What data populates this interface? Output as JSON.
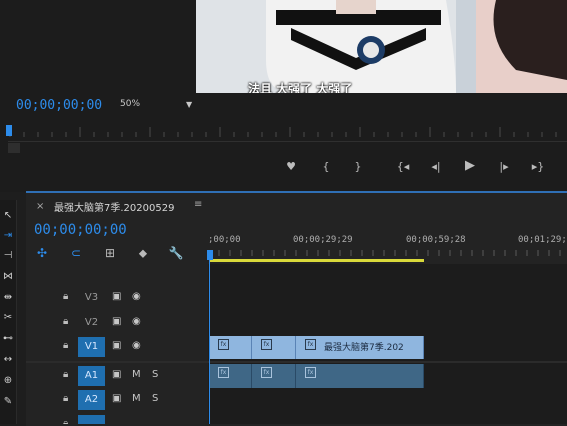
{
  "monitor": {
    "timecode": "00;00;00;00",
    "zoom": "50%",
    "video_caption": "法且 大强了 大强了",
    "transport": [
      "marker-icon",
      "mark-in-icon",
      "mark-out-icon",
      "go-to-in-icon",
      "step-back-icon",
      "play-icon",
      "step-forward-icon",
      "go-to-out-icon"
    ]
  },
  "timeline": {
    "tab_close": "×",
    "sequence_name": "最强大脑第7季.20200529",
    "tab_menu": "≡",
    "timecode": "00;00;00;00",
    "ruler": [
      ";00;00",
      "00;00;29;29",
      "00;00;59;28",
      "00;01;29;"
    ],
    "tracks": [
      {
        "target": "",
        "name": "V3",
        "type": "video"
      },
      {
        "target": "",
        "name": "V2",
        "type": "video"
      },
      {
        "target": "V1",
        "name": "V1",
        "type": "video",
        "active": true
      },
      {
        "target": "A1",
        "name": "A1",
        "type": "audio",
        "active": true
      },
      {
        "target": "A2",
        "name": "A2",
        "type": "audio",
        "active": true
      }
    ],
    "audio_m": "M",
    "audio_s": "S",
    "clip_label": "最强大脑第7季.202"
  },
  "colors": {
    "accent_blue": "#2d8ceb",
    "track_target": "#1f6fb0",
    "video_clip": "#8fb6df",
    "audio_clip": "#3f6786",
    "work_area": "#d9d93a"
  }
}
